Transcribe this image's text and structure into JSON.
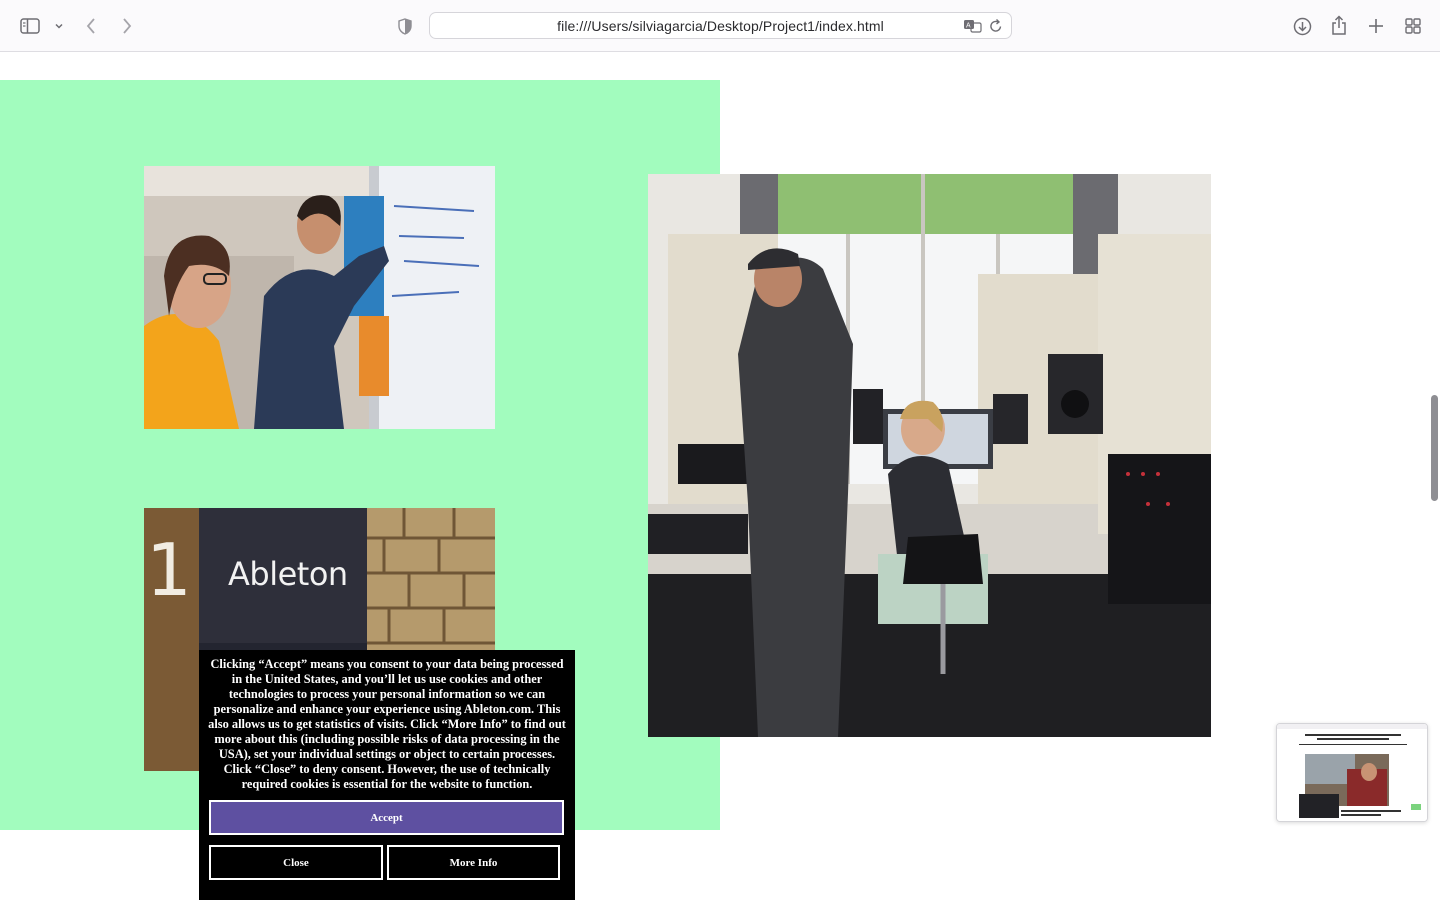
{
  "browser": {
    "url": "file:///Users/silviagarcia/Desktop/Project1/index.html",
    "icons": [
      "sidebar-icon",
      "chevron-down-icon",
      "back-icon",
      "forward-icon",
      "privacy-shield-icon",
      "translate-icon",
      "reload-icon",
      "download-icon",
      "share-icon",
      "new-tab-icon",
      "tab-overview-icon"
    ]
  },
  "page": {
    "green_color": "#a2fcbe",
    "sign_text": "Ableton",
    "sign_number": "1"
  },
  "cookie_banner": {
    "text": "Clicking “Accept” means you consent to your data being processed in the United States, and you’ll let us use cookies and other technologies to process your personal information so we can personalize and enhance your experience using Ableton.com. This also allows us to get statistics of visits. Click “More Info” to find out more about this (including possible risks of data processing in the USA), set your individual settings or object to certain processes. Click “Close” to deny consent. However, the use of technically required cookies is essential for the website to function.",
    "accept_label": "Accept",
    "close_label": "Close",
    "more_info_label": "More Info",
    "accept_color": "#5e50a1"
  }
}
